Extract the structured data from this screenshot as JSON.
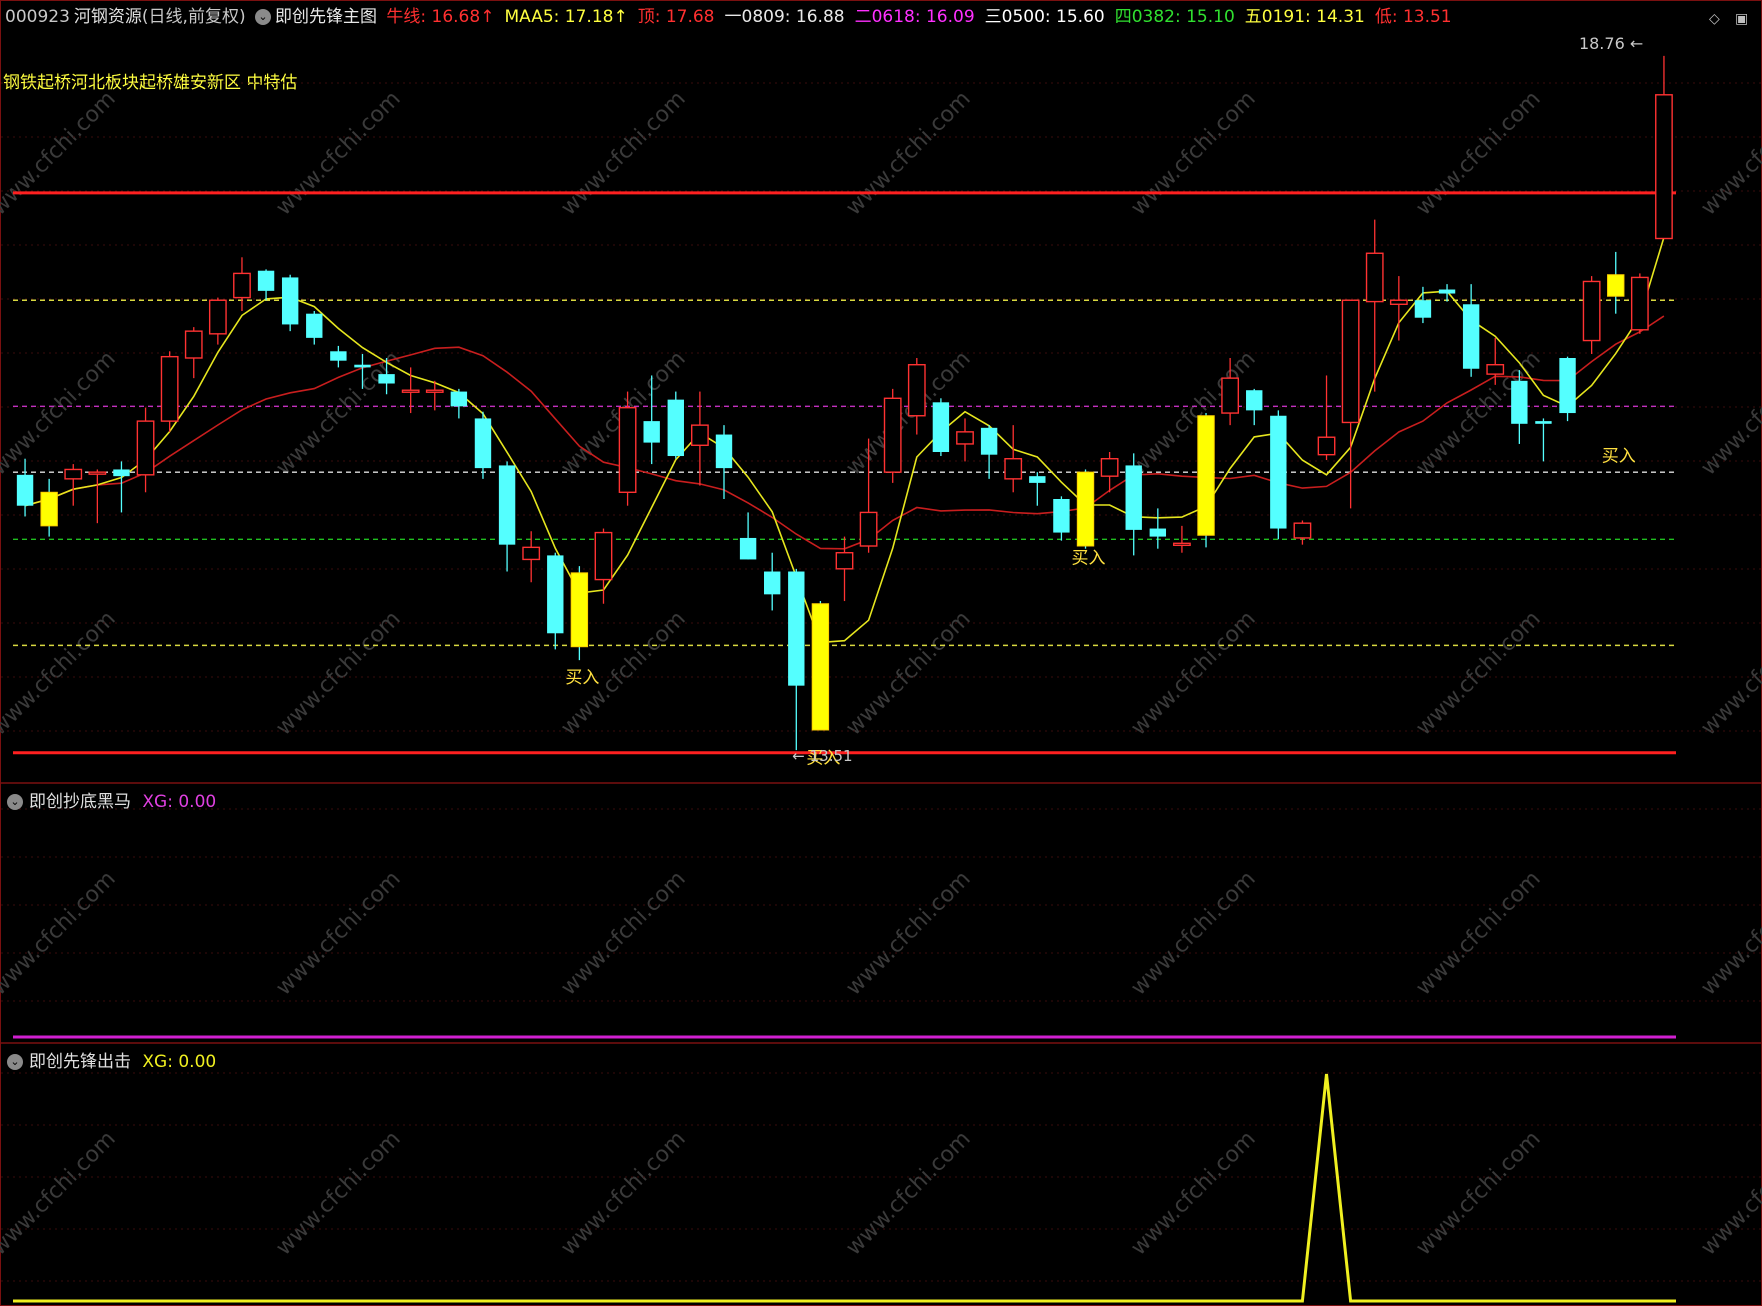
{
  "header": {
    "code": "000923",
    "name": "河钢资源",
    "period": "(日线,前复权)",
    "indicator_name": "即创先锋主图",
    "readouts": [
      {
        "label": "牛线: ",
        "value": "16.68",
        "arrow": "↑",
        "color": "#ff3030"
      },
      {
        "label": "MAA5: ",
        "value": "17.18",
        "arrow": "↑",
        "color": "#ffff40"
      },
      {
        "label": "顶: ",
        "value": "17.68",
        "arrow": "",
        "color": "#ff3030"
      },
      {
        "label": "一0809: ",
        "value": "16.88",
        "arrow": "",
        "color": "#e8e8e8"
      },
      {
        "label": "二0618: ",
        "value": "16.09",
        "arrow": "",
        "color": "#ff30ff"
      },
      {
        "label": "三0500: ",
        "value": "15.60",
        "arrow": "",
        "color": "#ffffff"
      },
      {
        "label": "四0382: ",
        "value": "15.10",
        "arrow": "",
        "color": "#30e030"
      },
      {
        "label": "五0191: ",
        "value": "14.31",
        "arrow": "",
        "color": "#ffff40"
      },
      {
        "label": "低: ",
        "value": "13.51",
        "arrow": "",
        "color": "#ff3030"
      }
    ]
  },
  "banner": "钢铁起桥河北板块起桥雄安新区 中特估",
  "watermark": "www.cfchi.com",
  "panes": {
    "lower1": {
      "title": "即创抄底黑马",
      "xg_label": "XG: 0.00"
    },
    "lower2": {
      "title": "即创先锋出击",
      "xg_label": "XG: 0.00"
    }
  },
  "chart_data": [
    {
      "type": "candlestick",
      "title": "即创先锋主图",
      "ylim": [
        13.3,
        18.9
      ],
      "price_levels": [
        {
          "name": "顶",
          "value": 17.68,
          "color": "#ff2020",
          "style": "solid"
        },
        {
          "name": "一",
          "value": 16.88,
          "color": "#d8d840",
          "style": "dashed"
        },
        {
          "name": "二",
          "value": 16.09,
          "color": "#c030c0",
          "style": "dashed"
        },
        {
          "name": "三",
          "value": 15.6,
          "color": "#e0e0e0",
          "style": "dashed"
        },
        {
          "name": "四",
          "value": 15.1,
          "color": "#20c020",
          "style": "dashed"
        },
        {
          "name": "五",
          "value": 14.31,
          "color": "#d8d840",
          "style": "dashed"
        },
        {
          "name": "低",
          "value": 13.51,
          "color": "#ff2020",
          "style": "solid"
        }
      ],
      "candles": [
        {
          "o": 15.58,
          "h": 15.7,
          "l": 15.27,
          "c": 15.35
        },
        {
          "o": 15.2,
          "h": 15.55,
          "l": 15.12,
          "c": 15.45
        },
        {
          "o": 15.55,
          "h": 15.66,
          "l": 15.35,
          "c": 15.62
        },
        {
          "o": 15.6,
          "h": 15.62,
          "l": 15.22,
          "c": 15.6
        },
        {
          "o": 15.62,
          "h": 15.68,
          "l": 15.3,
          "c": 15.57
        },
        {
          "o": 15.58,
          "h": 16.08,
          "l": 15.45,
          "c": 15.98
        },
        {
          "o": 15.98,
          "h": 16.5,
          "l": 15.9,
          "c": 16.46
        },
        {
          "o": 16.45,
          "h": 16.68,
          "l": 16.3,
          "c": 16.65
        },
        {
          "o": 16.63,
          "h": 16.9,
          "l": 16.55,
          "c": 16.88
        },
        {
          "o": 16.9,
          "h": 17.2,
          "l": 16.8,
          "c": 17.08
        },
        {
          "o": 17.1,
          "h": 17.11,
          "l": 16.88,
          "c": 16.95
        },
        {
          "o": 17.05,
          "h": 17.07,
          "l": 16.65,
          "c": 16.7
        },
        {
          "o": 16.78,
          "h": 16.8,
          "l": 16.55,
          "c": 16.6
        },
        {
          "o": 16.5,
          "h": 16.54,
          "l": 16.38,
          "c": 16.43
        },
        {
          "o": 16.4,
          "h": 16.48,
          "l": 16.22,
          "c": 16.38
        },
        {
          "o": 16.33,
          "h": 16.45,
          "l": 16.18,
          "c": 16.26
        },
        {
          "o": 16.21,
          "h": 16.38,
          "l": 16.04,
          "c": 16.21
        },
        {
          "o": 16.21,
          "h": 16.28,
          "l": 16.06,
          "c": 16.21
        },
        {
          "o": 16.2,
          "h": 16.22,
          "l": 16.0,
          "c": 16.09
        },
        {
          "o": 16.0,
          "h": 16.05,
          "l": 15.55,
          "c": 15.63
        },
        {
          "o": 15.65,
          "h": 15.68,
          "l": 14.86,
          "c": 15.06
        },
        {
          "o": 14.95,
          "h": 15.16,
          "l": 14.78,
          "c": 15.04
        },
        {
          "o": 14.98,
          "h": 15.0,
          "l": 14.28,
          "c": 14.4
        },
        {
          "o": 14.85,
          "h": 14.9,
          "l": 14.2,
          "c": 14.3
        },
        {
          "o": 14.8,
          "h": 15.18,
          "l": 14.62,
          "c": 15.15
        },
        {
          "o": 15.45,
          "h": 16.2,
          "l": 15.35,
          "c": 16.08
        },
        {
          "o": 15.98,
          "h": 16.32,
          "l": 15.66,
          "c": 15.82
        },
        {
          "o": 16.14,
          "h": 16.2,
          "l": 15.7,
          "c": 15.72
        },
        {
          "o": 15.8,
          "h": 16.2,
          "l": 15.5,
          "c": 15.95
        },
        {
          "o": 15.88,
          "h": 15.95,
          "l": 15.4,
          "c": 15.63
        },
        {
          "o": 15.11,
          "h": 15.3,
          "l": 14.95,
          "c": 14.95
        },
        {
          "o": 14.86,
          "h": 15.0,
          "l": 14.57,
          "c": 14.69
        },
        {
          "o": 14.86,
          "h": 14.88,
          "l": 13.53,
          "c": 14.01
        },
        {
          "o": 14.62,
          "h": 14.64,
          "l": 13.68,
          "c": 13.68
        },
        {
          "o": 14.88,
          "h": 15.12,
          "l": 14.64,
          "c": 15.0
        },
        {
          "o": 15.05,
          "h": 15.85,
          "l": 15.0,
          "c": 15.3
        },
        {
          "o": 15.6,
          "h": 16.22,
          "l": 15.52,
          "c": 16.15
        },
        {
          "o": 16.02,
          "h": 16.45,
          "l": 15.88,
          "c": 16.4
        },
        {
          "o": 16.12,
          "h": 16.15,
          "l": 15.72,
          "c": 15.75
        },
        {
          "o": 15.81,
          "h": 16.0,
          "l": 15.68,
          "c": 15.9
        },
        {
          "o": 15.93,
          "h": 15.95,
          "l": 15.55,
          "c": 15.73
        },
        {
          "o": 15.55,
          "h": 15.95,
          "l": 15.45,
          "c": 15.7
        },
        {
          "o": 15.57,
          "h": 15.6,
          "l": 15.35,
          "c": 15.52
        },
        {
          "o": 15.4,
          "h": 15.42,
          "l": 15.09,
          "c": 15.15
        },
        {
          "o": 15.6,
          "h": 15.62,
          "l": 15.03,
          "c": 15.05
        },
        {
          "o": 15.57,
          "h": 15.75,
          "l": 15.45,
          "c": 15.7
        },
        {
          "o": 15.65,
          "h": 15.74,
          "l": 14.98,
          "c": 15.17
        },
        {
          "o": 15.18,
          "h": 15.33,
          "l": 15.03,
          "c": 15.12
        },
        {
          "o": 15.07,
          "h": 15.2,
          "l": 15.0,
          "c": 15.07
        },
        {
          "o": 15.13,
          "h": 16.04,
          "l": 15.04,
          "c": 16.02
        },
        {
          "o": 16.04,
          "h": 16.45,
          "l": 15.95,
          "c": 16.3
        },
        {
          "o": 16.21,
          "h": 16.22,
          "l": 15.95,
          "c": 16.06
        },
        {
          "o": 16.02,
          "h": 16.06,
          "l": 15.1,
          "c": 15.18
        },
        {
          "o": 15.11,
          "h": 15.24,
          "l": 15.06,
          "c": 15.22
        },
        {
          "o": 15.73,
          "h": 16.32,
          "l": 15.69,
          "c": 15.86
        },
        {
          "o": 15.97,
          "h": 16.75,
          "l": 15.33,
          "c": 16.88
        },
        {
          "o": 16.87,
          "h": 17.48,
          "l": 16.2,
          "c": 17.23
        },
        {
          "o": 16.85,
          "h": 17.06,
          "l": 16.58,
          "c": 16.88
        },
        {
          "o": 16.88,
          "h": 16.98,
          "l": 16.71,
          "c": 16.75
        },
        {
          "o": 16.96,
          "h": 17.0,
          "l": 16.87,
          "c": 16.93
        },
        {
          "o": 16.85,
          "h": 17.0,
          "l": 16.31,
          "c": 16.37
        },
        {
          "o": 16.33,
          "h": 16.6,
          "l": 16.25,
          "c": 16.4
        },
        {
          "o": 16.28,
          "h": 16.36,
          "l": 15.81,
          "c": 15.96
        },
        {
          "o": 15.98,
          "h": 16.0,
          "l": 15.68,
          "c": 15.96
        },
        {
          "o": 16.45,
          "h": 16.46,
          "l": 15.98,
          "c": 16.04
        },
        {
          "o": 16.58,
          "h": 17.06,
          "l": 16.48,
          "c": 17.02
        },
        {
          "o": 17.07,
          "h": 17.24,
          "l": 16.78,
          "c": 16.91
        },
        {
          "o": 16.66,
          "h": 17.08,
          "l": 16.63,
          "c": 17.05
        },
        {
          "o": 17.34,
          "h": 18.7,
          "l": 17.35,
          "c": 18.41
        }
      ],
      "yellow_bars": [
        1,
        23,
        33,
        44,
        49,
        66
      ],
      "buy_labels": [
        {
          "index": 23,
          "text": "买入",
          "price": 14.15
        },
        {
          "index": 33,
          "text": "买入",
          "price": 13.55
        },
        {
          "index": 44,
          "text": "买入",
          "price": 15.04
        },
        {
          "index": 66,
          "text": "买入",
          "price": 15.8
        }
      ],
      "high_annotation": {
        "text": "18.76",
        "index": 68
      },
      "low_annotation": {
        "text": "13.51",
        "index": 32
      },
      "ma_fast_color": "#e6e61e",
      "ma_slow_color": "#c81e1e"
    },
    {
      "type": "line",
      "title": "即创抄底黑马",
      "series": [
        {
          "name": "XG",
          "color": "#d020d0",
          "values": [
            0,
            0,
            0,
            0,
            0,
            0,
            0,
            0,
            0,
            0,
            0,
            0,
            0,
            0,
            0,
            0,
            0,
            0,
            0,
            0,
            0,
            0,
            0,
            0,
            0,
            0,
            0,
            0,
            0,
            0,
            0,
            0,
            0,
            0,
            0,
            0,
            0,
            0,
            0,
            0,
            0,
            0,
            0,
            0,
            0,
            0,
            0,
            0,
            0,
            0,
            0,
            0,
            0,
            0,
            0,
            0,
            0,
            0,
            0,
            0,
            0,
            0,
            0,
            0,
            0,
            0,
            0,
            0,
            0
          ]
        }
      ],
      "ylim": [
        0,
        1
      ]
    },
    {
      "type": "line",
      "title": "即创先锋出击",
      "series": [
        {
          "name": "XG",
          "color": "#f0f020",
          "values": [
            0,
            0,
            0,
            0,
            0,
            0,
            0,
            0,
            0,
            0,
            0,
            0,
            0,
            0,
            0,
            0,
            0,
            0,
            0,
            0,
            0,
            0,
            0,
            0,
            0,
            0,
            0,
            0,
            0,
            0,
            0,
            0,
            0,
            0,
            0,
            0,
            0,
            0,
            0,
            0,
            0,
            0,
            0,
            0,
            0,
            0,
            0,
            0,
            0,
            0,
            0,
            0,
            0,
            0,
            1,
            0,
            0,
            0,
            0,
            0,
            0,
            0,
            0,
            0,
            0,
            0,
            0,
            0,
            0
          ]
        }
      ],
      "ylim": [
        0,
        1
      ]
    }
  ]
}
